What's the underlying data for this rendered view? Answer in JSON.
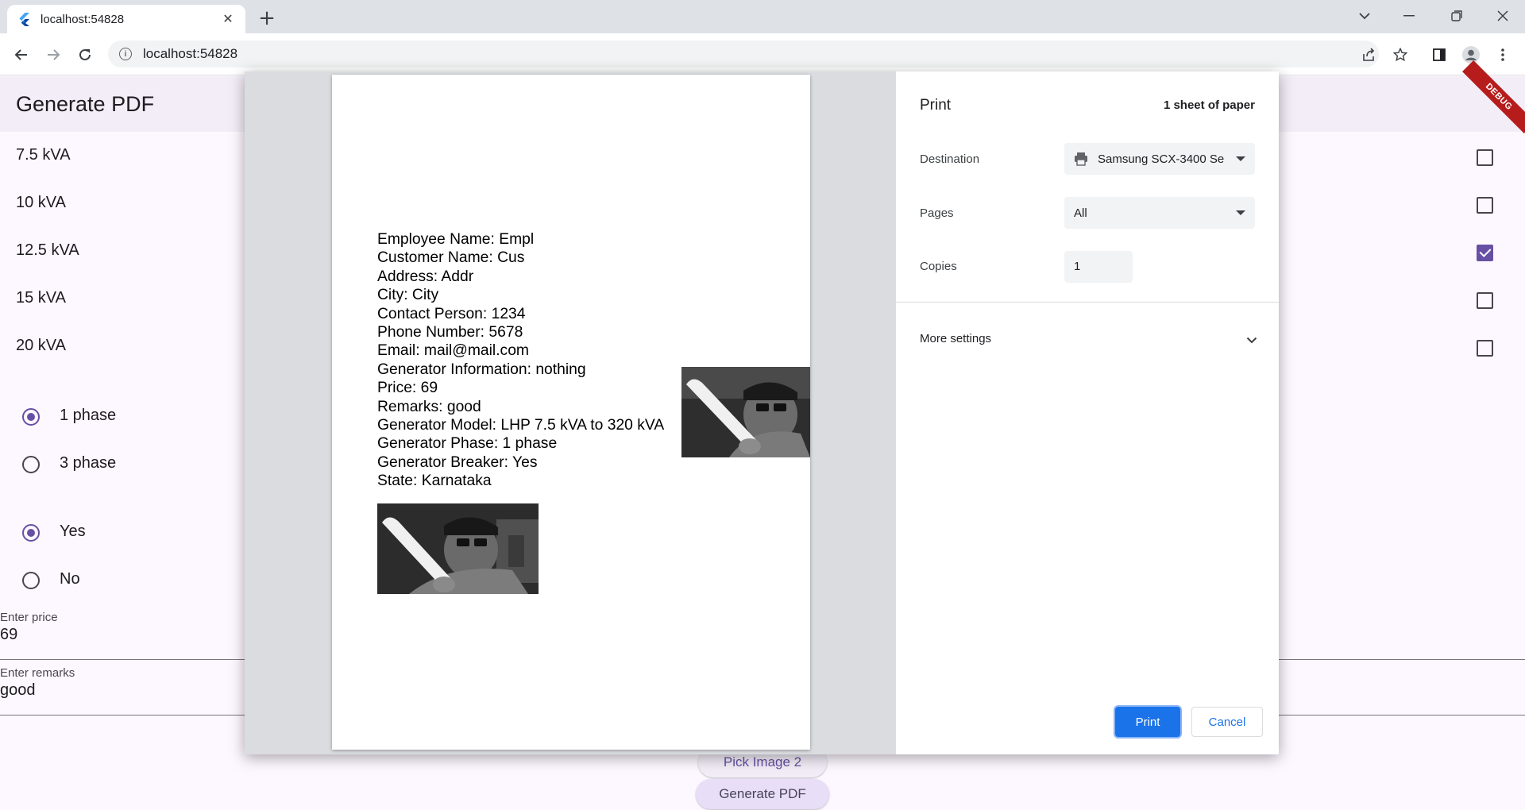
{
  "browser": {
    "tab_title": "localhost:54828",
    "url": "localhost:54828"
  },
  "app": {
    "title": "Generate PDF",
    "debug_banner": "DEBUG",
    "accent": "#6750a4",
    "kva_options": [
      {
        "label": "7.5 kVA",
        "checked": false
      },
      {
        "label": "10 kVA",
        "checked": false
      },
      {
        "label": "12.5 kVA",
        "checked": true
      },
      {
        "label": "15 kVA",
        "checked": false
      },
      {
        "label": "20 kVA",
        "checked": false
      }
    ],
    "phase_options": [
      {
        "label": "1 phase",
        "selected": true
      },
      {
        "label": "3 phase",
        "selected": false
      }
    ],
    "breaker_options": [
      {
        "label": "Yes",
        "selected": true
      },
      {
        "label": "No",
        "selected": false
      }
    ],
    "price_field": {
      "label": "Enter price",
      "value": "69"
    },
    "remarks_field": {
      "label": "Enter remarks",
      "value": "good"
    },
    "pick_image_2_label": "Pick Image 2",
    "generate_pdf_label": "Generate PDF"
  },
  "print_dialog": {
    "title": "Print",
    "sheet_count": "1 sheet of paper",
    "destination_label": "Destination",
    "destination_value": "Samsung SCX-3400 Se",
    "pages_label": "Pages",
    "pages_value": "All",
    "copies_label": "Copies",
    "copies_value": "1",
    "more_settings_label": "More settings",
    "print_button": "Print",
    "cancel_button": "Cancel",
    "primary_color": "#1a73e8",
    "preview_lines": [
      "Employee Name: Empl",
      "Customer Name: Cus",
      "Address: Addr",
      "City: City",
      "Contact Person: 1234",
      "Phone Number: 5678",
      "Email: mail@mail.com",
      "Generator Information: nothing",
      "Price: 69",
      "Remarks: good",
      "Generator Model: LHP 7.5 kVA to 320 kVA",
      "Generator Phase: 1 phase",
      "Generator Breaker: Yes",
      "State: Karnataka"
    ]
  }
}
